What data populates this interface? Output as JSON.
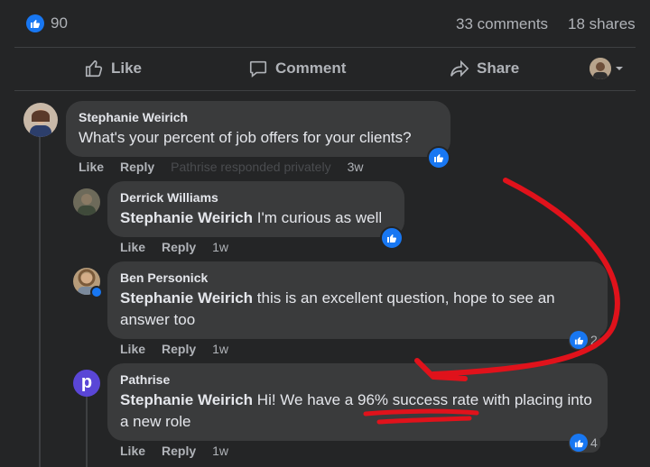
{
  "stats": {
    "reaction_count": "90",
    "comments": "33 comments",
    "shares": "18 shares"
  },
  "actions": {
    "like": "Like",
    "comment": "Comment",
    "share": "Share"
  },
  "comments": [
    {
      "name": "Stephanie Weirich",
      "text": "What's your percent of job offers for your clients?",
      "like": "Like",
      "reply": "Reply",
      "note": "Pathrise responded privately",
      "time": "3w",
      "reactions": ""
    },
    {
      "name": "Derrick Williams",
      "mention": "Stephanie Weirich",
      "text": "I'm curious as well",
      "like": "Like",
      "reply": "Reply",
      "time": "1w",
      "reactions": ""
    },
    {
      "name": "Ben Personick",
      "mention": "Stephanie Weirich",
      "text": "this is an excellent question, hope to see an answer too",
      "like": "Like",
      "reply": "Reply",
      "time": "1w",
      "reactions": "2"
    },
    {
      "name": "Pathrise",
      "avatar_letter": "p",
      "mention": "Stephanie Weirich",
      "text_pre": "Hi! We have a ",
      "text_highlight": "96% success",
      "text_post": " rate with placing into a new role",
      "like": "Like",
      "reply": "Reply",
      "time": "1w",
      "reactions": "4"
    }
  ],
  "colors": {
    "background": "#242526",
    "bubble": "#3a3b3c",
    "like_blue": "#1877f2",
    "annotation_red": "#e0121b",
    "pathrise_purple": "#5a46d6"
  }
}
